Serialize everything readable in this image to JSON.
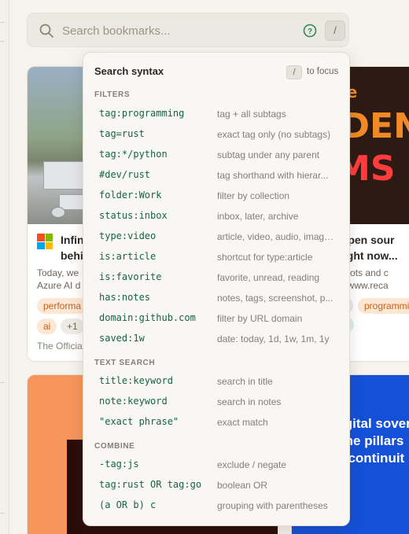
{
  "search": {
    "placeholder": "Search bookmarks...",
    "shortcut_key": "/"
  },
  "cards": [
    {
      "title": "Infin",
      "title_line2": "behi",
      "desc_line1": "Today, we",
      "desc_line2": "Azure AI d",
      "tags": [
        "performa",
        "ai",
        "+1"
      ],
      "source": "The Officia"
    },
    {
      "thumb_small": "ource",
      "thumb_big": "DDEN",
      "thumb_big2": "EMS",
      "title_line1": "w open sour",
      "title_line2": "d right now...",
      "desc_line1": "ing bots and c",
      "desc_line2": "ps://www.reca",
      "tags": [
        "programmi",
        "urce"
      ]
    },
    {},
    {
      "line1": "igital sover",
      "line2": "the pillars",
      "line3": ", continuit"
    }
  ],
  "popover": {
    "title": "Search syntax",
    "focus_key": "/",
    "focus_text": "to focus",
    "sections": [
      {
        "title": "FILTERS",
        "rows": [
          {
            "syntax": "tag:programming",
            "desc": "tag + all subtags"
          },
          {
            "syntax": "tag=rust",
            "desc": "exact tag only (no subtags)"
          },
          {
            "syntax": "tag:*/python",
            "desc": "subtag under any parent"
          },
          {
            "syntax": "#dev/rust",
            "desc": "tag shorthand with hierar..."
          },
          {
            "syntax": "folder:Work",
            "desc": "filter by collection"
          },
          {
            "syntax": "status:inbox",
            "desc": "inbox, later, archive"
          },
          {
            "syntax": "type:video",
            "desc": "article, video, audio, image..."
          },
          {
            "syntax": "is:article",
            "desc": "shortcut for type:article"
          },
          {
            "syntax": "is:favorite",
            "desc": "favorite, unread, reading"
          },
          {
            "syntax": "has:notes",
            "desc": "notes, tags, screenshot, p..."
          },
          {
            "syntax": "domain:github.com",
            "desc": "filter by URL domain"
          },
          {
            "syntax": "saved:1w",
            "desc": "date: today, 1d, 1w, 1m, 1y"
          }
        ]
      },
      {
        "title": "TEXT SEARCH",
        "rows": [
          {
            "syntax": "title:keyword",
            "desc": "search in title"
          },
          {
            "syntax": "note:keyword",
            "desc": "search in notes"
          },
          {
            "syntax": "\"exact phrase\"",
            "desc": "exact match"
          }
        ]
      },
      {
        "title": "COMBINE",
        "rows": [
          {
            "syntax": "-tag:js",
            "desc": "exclude / negate"
          },
          {
            "syntax": "tag:rust OR tag:go",
            "desc": "boolean OR"
          },
          {
            "syntax": "(a OR b) c",
            "desc": "grouping with parentheses"
          }
        ]
      }
    ]
  },
  "colors": {
    "accent_green": "#16624a",
    "help_icon": "#2f8a5a",
    "tag_orange": "#c2621f"
  }
}
